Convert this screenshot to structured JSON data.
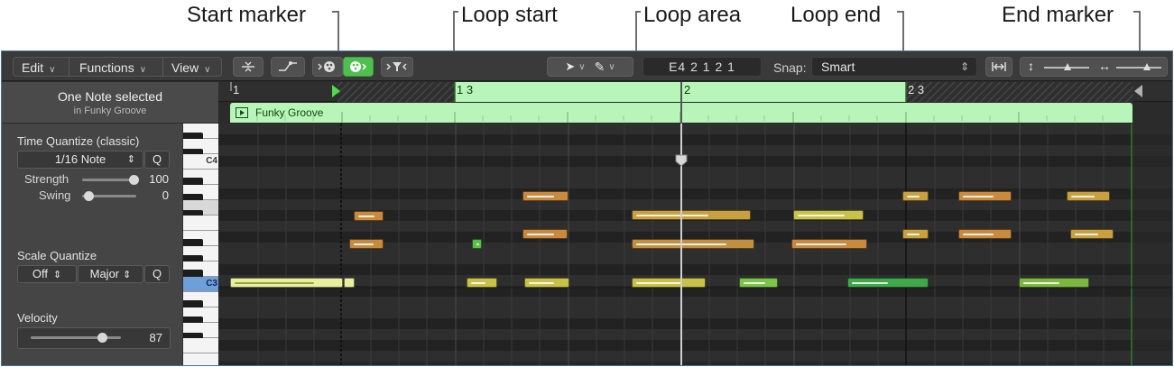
{
  "callouts": {
    "start_marker": "Start marker",
    "loop_start": "Loop start",
    "loop_area": "Loop area",
    "loop_end": "Loop end",
    "end_marker": "End marker"
  },
  "toolbar": {
    "edit_menu": "Edit",
    "functions_menu": "Functions",
    "view_menu": "View",
    "lcd_display": "E4  2 1 2 1",
    "snap_label": "Snap:",
    "snap_value": "Smart"
  },
  "inspector": {
    "selection_title": "One Note selected",
    "selection_subtitle": "in Funky Groove",
    "time_quantize_label": "Time Quantize (classic)",
    "time_quantize_value": "1/16 Note",
    "quantize_button": "Q",
    "strength_label": "Strength",
    "strength_value": "100",
    "swing_label": "Swing",
    "swing_value": "0",
    "scale_quantize_label": "Scale Quantize",
    "scale_root": "Off",
    "scale_type": "Major",
    "scale_q_button": "Q",
    "velocity_label": "Velocity",
    "velocity_value": "87"
  },
  "keyboard": {
    "c4_label": "C4",
    "c3_label": "C3"
  },
  "ruler": {
    "bar1": "1",
    "bar1_3": "1 3",
    "bar2": "2",
    "bar2_3": "2 3"
  },
  "region": {
    "name": "Funky Groove"
  },
  "colors": {
    "loop_area": "#b8f5b8",
    "note_orange": "#c98a3e",
    "note_yellow": "#c8c24a",
    "note_green": "#5cbf4a"
  }
}
